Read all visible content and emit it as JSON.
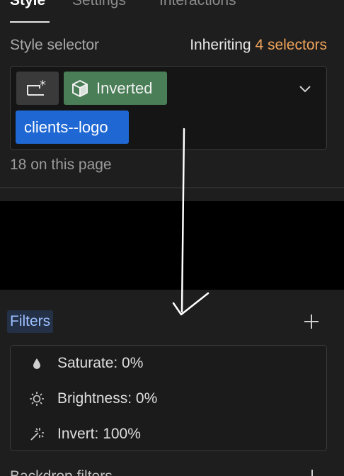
{
  "tabs": [
    {
      "label": "Style",
      "active": true
    },
    {
      "label": "Settings",
      "active": false
    },
    {
      "label": "Interactions",
      "active": false
    }
  ],
  "style_selector": {
    "label": "Style selector",
    "inheriting_prefix": "Inheriting",
    "inheriting_count": "4 selectors",
    "chips": {
      "state_icon": "state-selector-icon",
      "combo_label": "Inverted",
      "combo_icon": "component-cube-icon",
      "class_label": "clients--logo"
    },
    "page_count": "18 on this page"
  },
  "filters": {
    "label": "Filters",
    "items": [
      {
        "icon": "drop-icon",
        "label": "Saturate: 0%"
      },
      {
        "icon": "sun-icon",
        "label": "Brightness: 0%"
      },
      {
        "icon": "magic-wand-icon",
        "label": "Invert: 100%"
      }
    ]
  },
  "next_section_label": "Backdrop filters",
  "colors": {
    "panel_bg": "#1e1e1e",
    "accent_orange": "#f0a35a",
    "combo_green": "#4a7e57",
    "class_blue": "#1f68d3",
    "filters_label_blue": "#9dc0ff"
  }
}
